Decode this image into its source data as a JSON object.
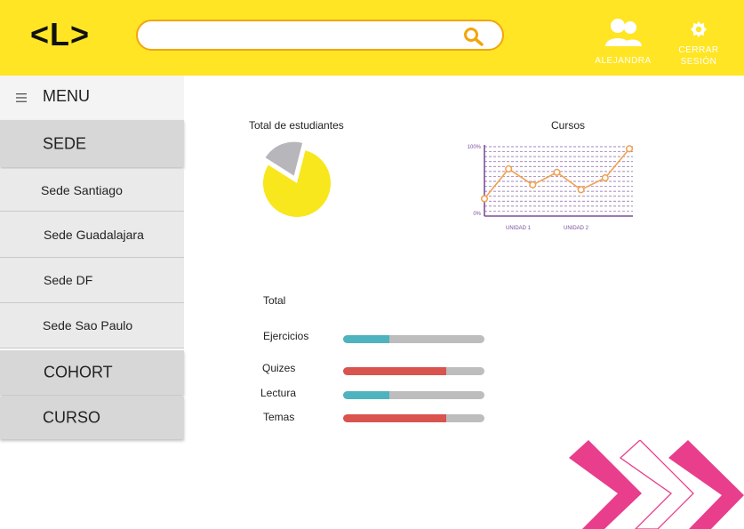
{
  "header": {
    "logo": "<L>",
    "search": {
      "value": "",
      "placeholder": ""
    },
    "user": {
      "label": "ALEJANDRA",
      "icon": "users-icon"
    },
    "logout": {
      "label": "CERRAR\nSESIÓN",
      "icon": "logout-icon"
    },
    "colors": {
      "background": "#ffe524",
      "search_border": "#f2a50c"
    }
  },
  "sidebar": {
    "menu_label": "MENU",
    "sections": {
      "sede": "SEDE",
      "cohort": "COHORT",
      "curso": "CURSO"
    },
    "sede_items": [
      "Sede Santiago",
      "Sede Guadalajara",
      "Sede DF",
      "Sede Sao Paulo"
    ]
  },
  "main": {
    "students_title": "Total de estudiantes",
    "courses_title": "Cursos",
    "total_label": "Total",
    "progress": [
      {
        "label": "Ejercicios",
        "value": 0.33,
        "color": "#4fb3bf"
      },
      {
        "label": "Quizes",
        "value": 0.73,
        "color": "#d9534f"
      },
      {
        "label": "Lectura",
        "value": 0.33,
        "color": "#4fb3bf"
      },
      {
        "label": "Temas",
        "value": 0.73,
        "color": "#d9534f"
      }
    ]
  },
  "chart_data": [
    {
      "type": "pie",
      "title": "Total de estudiantes",
      "values": [
        80,
        20
      ],
      "colors": [
        "#f8e71c",
        "#b7b6bb"
      ]
    },
    {
      "type": "line",
      "title": "Cursos",
      "x": [
        1,
        2,
        3,
        4,
        5,
        6,
        7
      ],
      "tick_labels": [
        "UNIDAD 1",
        "UNIDAD 2"
      ],
      "ytick_labels": [
        "100%",
        "0%"
      ],
      "ylim": [
        0,
        100
      ],
      "values": [
        25,
        68,
        45,
        63,
        38,
        55,
        97
      ],
      "grid": true,
      "colors": {
        "line": "#f0a050",
        "axis": "#7b4f9a",
        "grid": "#7b4f9a"
      }
    }
  ]
}
